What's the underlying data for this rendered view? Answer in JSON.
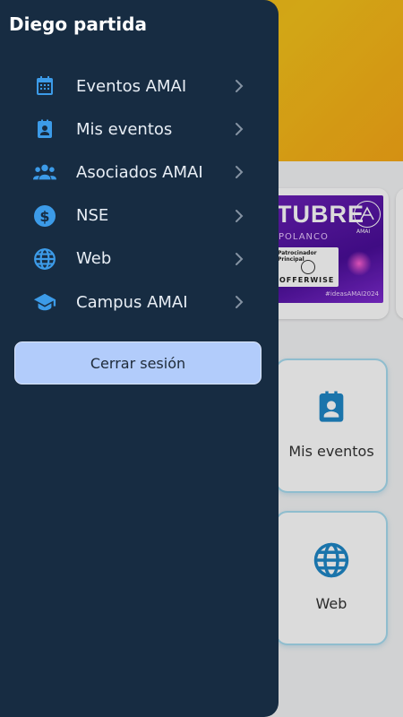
{
  "drawer": {
    "user_name": "Diego partida",
    "items": [
      {
        "label": "Eventos AMAI",
        "icon": "calendar-icon"
      },
      {
        "label": "Mis eventos",
        "icon": "event-badge-icon"
      },
      {
        "label": "Asociados AMAI",
        "icon": "group-icon"
      },
      {
        "label": "NSE",
        "icon": "dollar-circle-icon"
      },
      {
        "label": "Web",
        "icon": "globe-icon"
      },
      {
        "label": "Campus AMAI",
        "icon": "graduation-cap-icon"
      }
    ],
    "logout_label": "Cerrar sesión"
  },
  "background": {
    "banner": {
      "title": "TUBRE",
      "subtitle": "POLANCO",
      "logo_text": "AMAI",
      "sponsor_heading": "Patrocinador Principal",
      "sponsor_name": "OFFERWISE",
      "hashtag": "#ideasAMAI2024"
    },
    "tiles": [
      {
        "label": "Mis eventos",
        "icon": "event-badge-icon"
      },
      {
        "label": "Web",
        "icon": "globe-icon"
      }
    ]
  },
  "colors": {
    "drawer_bg": "#172c42",
    "icon_accent": "#3c9be8",
    "logout_bg": "#b2ccfb",
    "header_yellow": "#f5c21a",
    "tile_border": "#a7dcf0"
  }
}
